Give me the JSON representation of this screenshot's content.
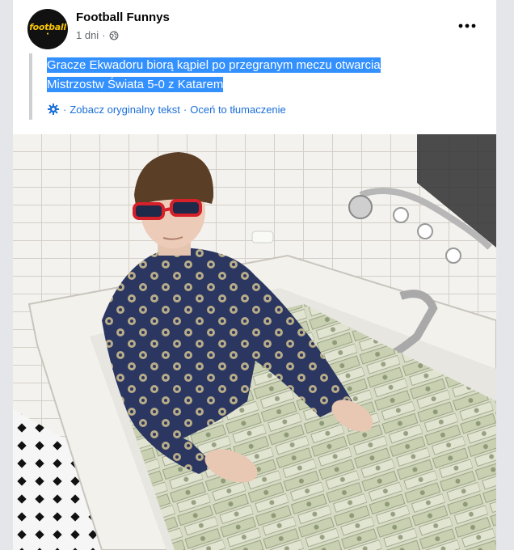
{
  "post": {
    "page_name": "Football Funnys",
    "time": "1 dni",
    "privacy_icon": "globe-icon",
    "more_icon": "more-icon",
    "avatar_logo": "football",
    "translated_text_line1": "Gracze Ekwadoru biorą kąpiel po przegranym meczu otwarcia",
    "translated_text_line2": "Mistrzostw Świata 5-0 z Katarem",
    "see_original": "Zobacz oryginalny tekst",
    "rate_translation": "Oceń to tłumaczenie",
    "separator": "·",
    "translate_icon": "gear-icon"
  },
  "colors": {
    "highlight": "#3390ff",
    "link": "#1a6ed8",
    "meta": "#65676b",
    "avatar_bg": "#111111",
    "logo": "#f5c400"
  }
}
